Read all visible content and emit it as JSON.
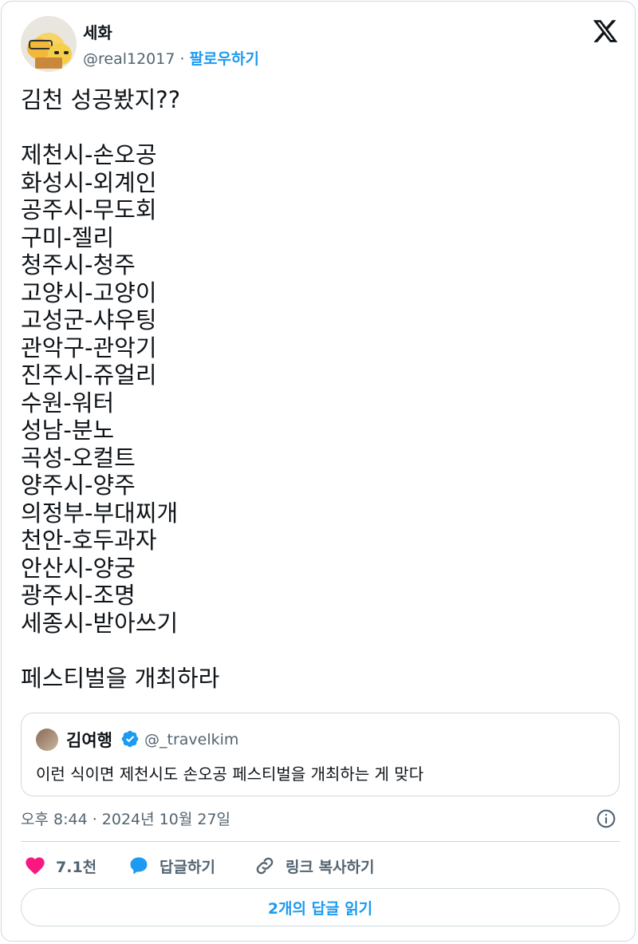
{
  "author": {
    "name": "세화",
    "handle": "@real12017",
    "separator": " · ",
    "follow_label": "팔로우하기"
  },
  "tweet": {
    "text": "김천 성공봤지??\n\n제천시-손오공\n화성시-외계인\n공주시-무도회\n구미-젤리\n청주시-청주\n고양시-고양이\n고성군-샤우팅\n관악구-관악기\n진주시-쥬얼리\n수원-워터\n성남-분노\n곡성-오컬트\n양주시-양주\n의정부-부대찌개\n천안-호두과자\n안산시-양궁\n광주시-조명\n세종시-받아쓰기\n\n페스티벌을 개최하라"
  },
  "quoted_tweet": {
    "name": "김여행",
    "handle": "@_travelkim",
    "text": "이런 식이면 제천시도 손오공 페스티벌을 개최하는 게 맞다"
  },
  "timestamp": "오후 8:44 · 2024년 10월 27일",
  "actions": {
    "like_count": "7.1천",
    "reply_label": "답글하기",
    "copy_link_label": "링크 복사하기"
  },
  "read_replies_label": "2개의 답글 읽기",
  "colors": {
    "accent": "#1d9bf0",
    "like": "#f91880",
    "secondary_text": "#536471",
    "border": "#cfd9de"
  }
}
